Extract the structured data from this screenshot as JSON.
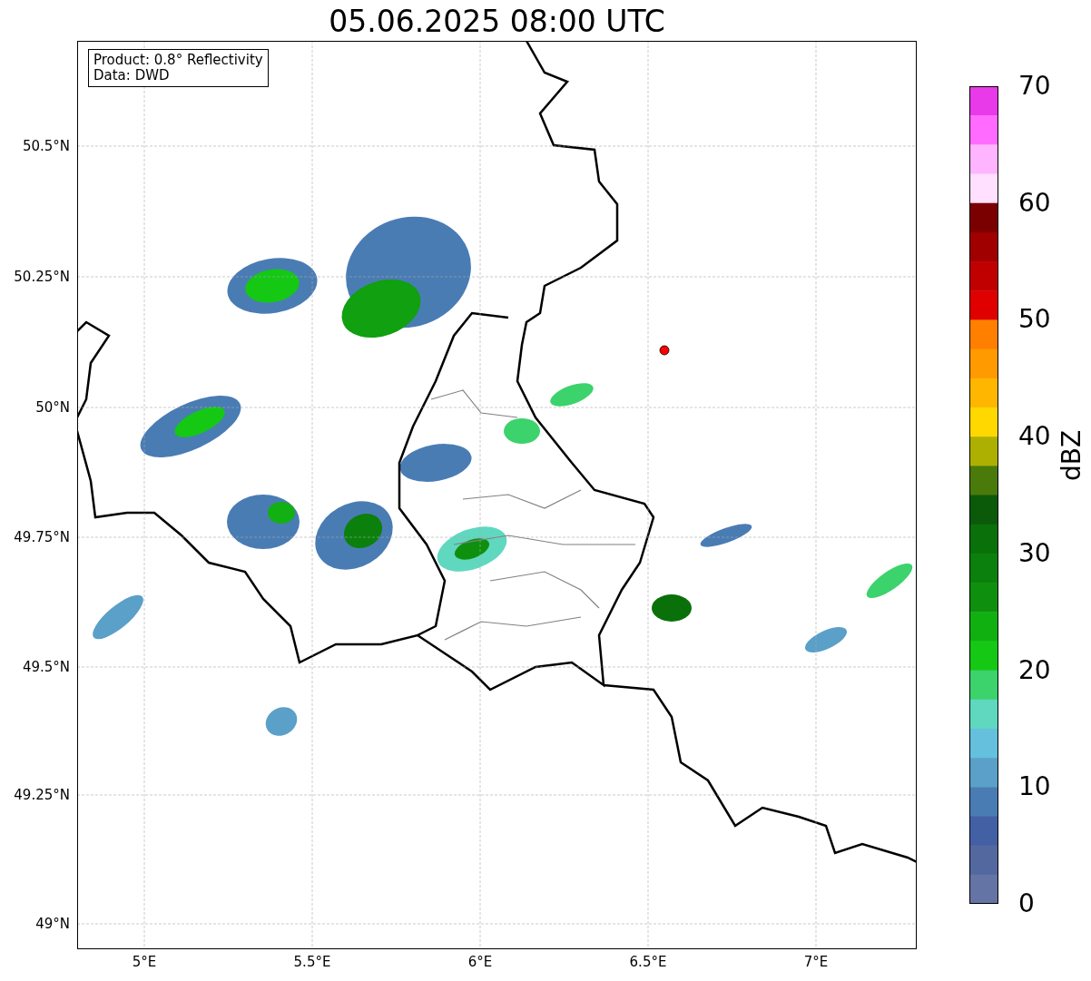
{
  "title": "05.06.2025 08:00 UTC",
  "legend": [
    "Product: 0.8° Reflectivity",
    "Data: DWD"
  ],
  "y_ticks": [
    "50.5°N",
    "50.25°N",
    "50°N",
    "49.75°N",
    "49.5°N",
    "49.25°N",
    "49°N"
  ],
  "x_ticks": [
    "5°E",
    "5.5°E",
    "6°E",
    "6.5°E",
    "7°E"
  ],
  "colorbar": {
    "label": "dBZ",
    "ticks": [
      "70",
      "60",
      "50",
      "40",
      "30",
      "20",
      "10",
      "0"
    ],
    "bins": [
      {
        "color": "#e83ae8"
      },
      {
        "color": "#ff6aff"
      },
      {
        "color": "#ffb4ff"
      },
      {
        "color": "#ffe0ff"
      },
      {
        "color": "#7a0000"
      },
      {
        "color": "#a00000"
      },
      {
        "color": "#c00000"
      },
      {
        "color": "#e00000"
      },
      {
        "color": "#ff7f00"
      },
      {
        "color": "#ff9a00"
      },
      {
        "color": "#ffb600"
      },
      {
        "color": "#ffd800"
      },
      {
        "color": "#adb000"
      },
      {
        "color": "#4a7a0a"
      },
      {
        "color": "#0a5a0a"
      },
      {
        "color": "#0a700a"
      },
      {
        "color": "#0c800c"
      },
      {
        "color": "#0e900e"
      },
      {
        "color": "#10b010"
      },
      {
        "color": "#14c814"
      },
      {
        "color": "#3cd26c"
      },
      {
        "color": "#60d8c0"
      },
      {
        "color": "#64c0dc"
      },
      {
        "color": "#5aa0c8"
      },
      {
        "color": "#4a7cb4"
      },
      {
        "color": "#4460a4"
      },
      {
        "color": "#5468a0"
      },
      {
        "color": "#6474a4"
      }
    ]
  }
}
